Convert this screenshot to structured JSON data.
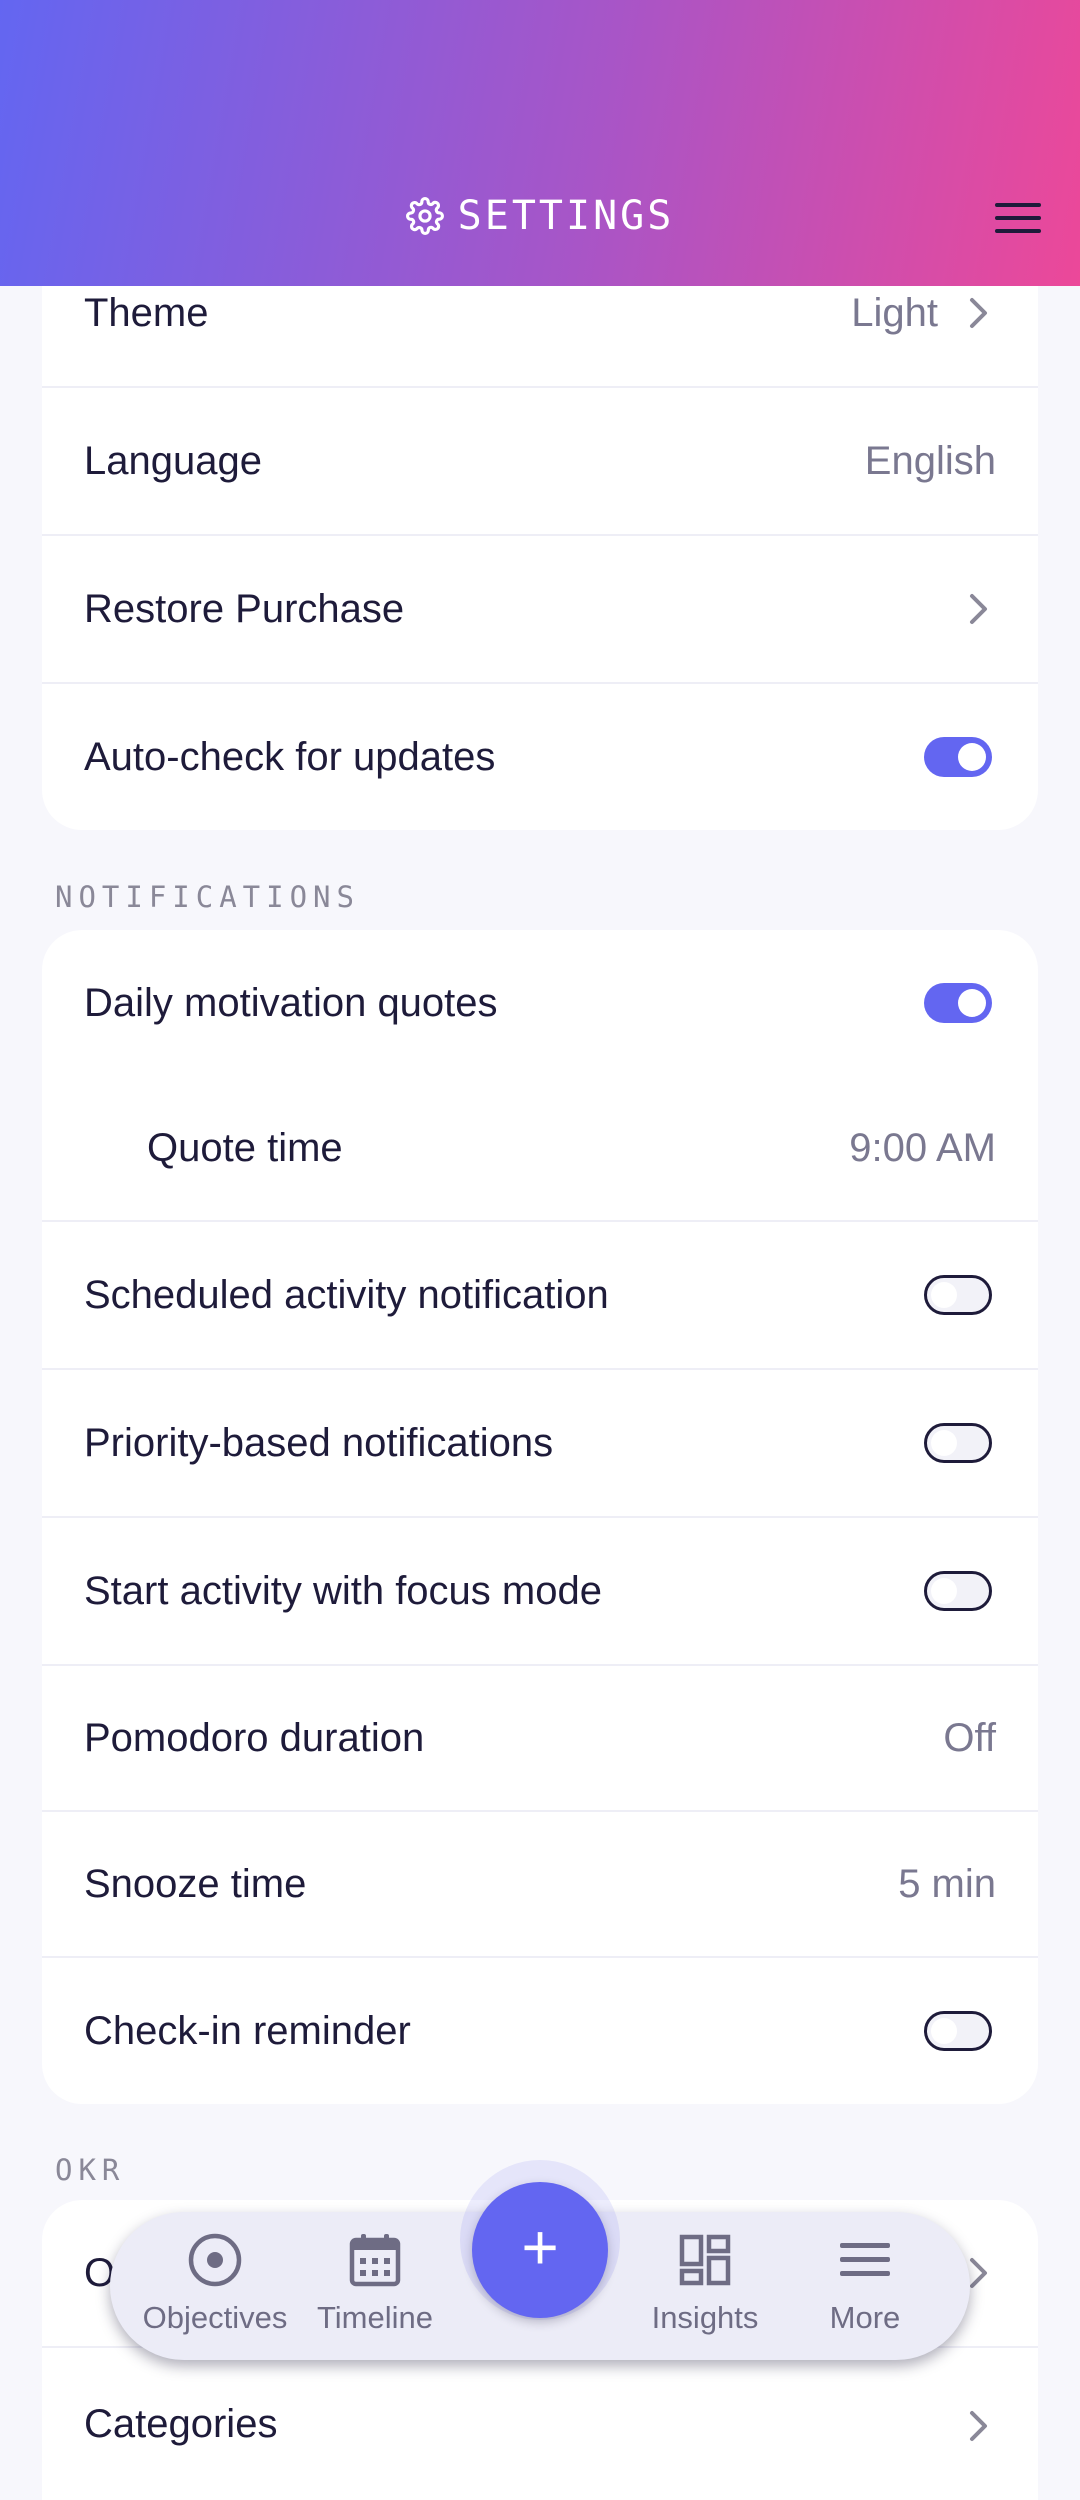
{
  "header": {
    "title": "SETTINGS",
    "icon": "gear-icon"
  },
  "general_rows": [
    {
      "label": "Theme",
      "value": "Light"
    },
    {
      "label": "Language",
      "value": "English"
    },
    {
      "label": "Restore Purchase"
    },
    {
      "label": "Auto-check for updates",
      "toggle": "on"
    }
  ],
  "notifications": {
    "section_label": "NOTIFICATIONS",
    "rows": [
      {
        "label": "Daily motivation quotes",
        "toggle": "on"
      },
      {
        "label": "Quote time",
        "value": "9:00 AM"
      },
      {
        "label": "Scheduled activity notification",
        "toggle": "off"
      },
      {
        "label": "Priority-based notifications",
        "toggle": "off"
      },
      {
        "label": "Start activity with focus mode",
        "toggle": "off"
      },
      {
        "label": "Pomodoro duration",
        "value": "Off"
      },
      {
        "label": "Snooze time",
        "value": "5 min"
      },
      {
        "label": "Check-in reminder",
        "toggle": "off"
      }
    ]
  },
  "okr": {
    "section_label": "OKR",
    "rows": [
      {
        "label": "O"
      },
      {
        "label": "Categories"
      }
    ]
  },
  "bottom_nav": {
    "items": [
      {
        "label": "Objectives",
        "icon": "target-icon"
      },
      {
        "label": "Timeline",
        "icon": "calendar-icon"
      },
      {
        "label": "Insights",
        "icon": "dashboard-icon"
      },
      {
        "label": "More",
        "icon": "menu-icon"
      }
    ],
    "fab_label": "+"
  },
  "colors": {
    "accent": "#6366f1",
    "gradient_start": "#6366f1",
    "gradient_end": "#ec4899",
    "text": "#1e1b3a"
  }
}
